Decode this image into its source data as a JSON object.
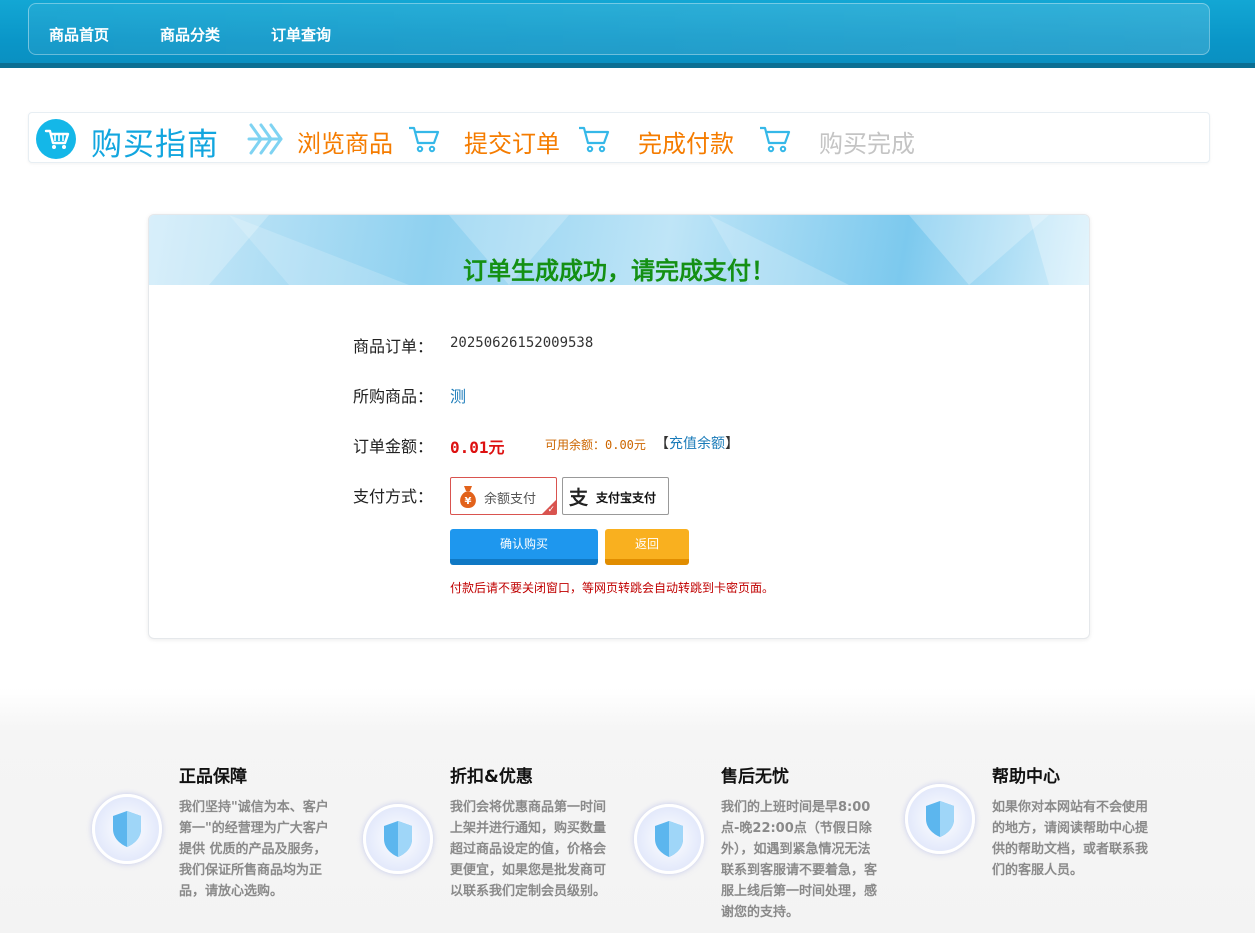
{
  "nav": {
    "items": [
      "商品首页",
      "商品分类",
      "订单查询"
    ]
  },
  "guide": {
    "title": "购买指南",
    "steps": [
      {
        "label": "浏览商品",
        "color": "#f57c00"
      },
      {
        "label": "提交订单",
        "color": "#f57c00"
      },
      {
        "label": "完成付款",
        "color": "#f57c00"
      },
      {
        "label": "购买完成",
        "color": "#c4c4c4"
      }
    ],
    "accent": "#12a6df"
  },
  "order": {
    "title": "订单生成成功，请完成支付！",
    "order_label": "商品订单：",
    "order_no": "20250626152009538",
    "product_label": "所购商品：",
    "product_name": "测",
    "amount_label": "订单金额：",
    "amount": "0.01元",
    "balance_text": "可用余额：0.00元",
    "bracket_open": "【",
    "recharge_label": "充值余额",
    "bracket_close": "】",
    "pay_label": "支付方式：",
    "pay_options": [
      {
        "label": "余额支付",
        "icon": "money-bag-icon",
        "selected": true
      },
      {
        "label": "支付宝支付",
        "icon": "alipay-icon",
        "selected": false
      }
    ],
    "confirm_label": "确认购买",
    "back_label": "返回",
    "notice": "付款后请不要关闭窗口，等网页转跳会自动转跳到卡密页面。"
  },
  "footer": {
    "features": [
      {
        "title": "正品保障",
        "text": "我们坚持\"诚信为本、客户第一\"的经营理为广大客户提供 优质的产品及服务，我们保证所售商品均为正品，请放心选购。",
        "icon": "shield-icon"
      },
      {
        "title": "折扣&优惠",
        "text": "我们会将优惠商品第一时间上架并进行通知，购买数量超过商品设定的值，价格会更便宜，如果您是批发商可以联系我们定制会员级别。",
        "icon": "shield-icon"
      },
      {
        "title": "售后无忧",
        "text": "我们的上班时间是早8:00点-晚22:00点（节假日除外），如遇到紧急情况无法联系到客服请不要着急，客服上线后第一时间处理，感谢您的支持。",
        "icon": "shield-icon"
      },
      {
        "title": "帮助中心",
        "text": "如果你对本网站有不会使用的地方，请阅读帮助中心提供的帮助文档，或者联系我们的客服人员。",
        "icon": "shield-icon"
      }
    ]
  }
}
